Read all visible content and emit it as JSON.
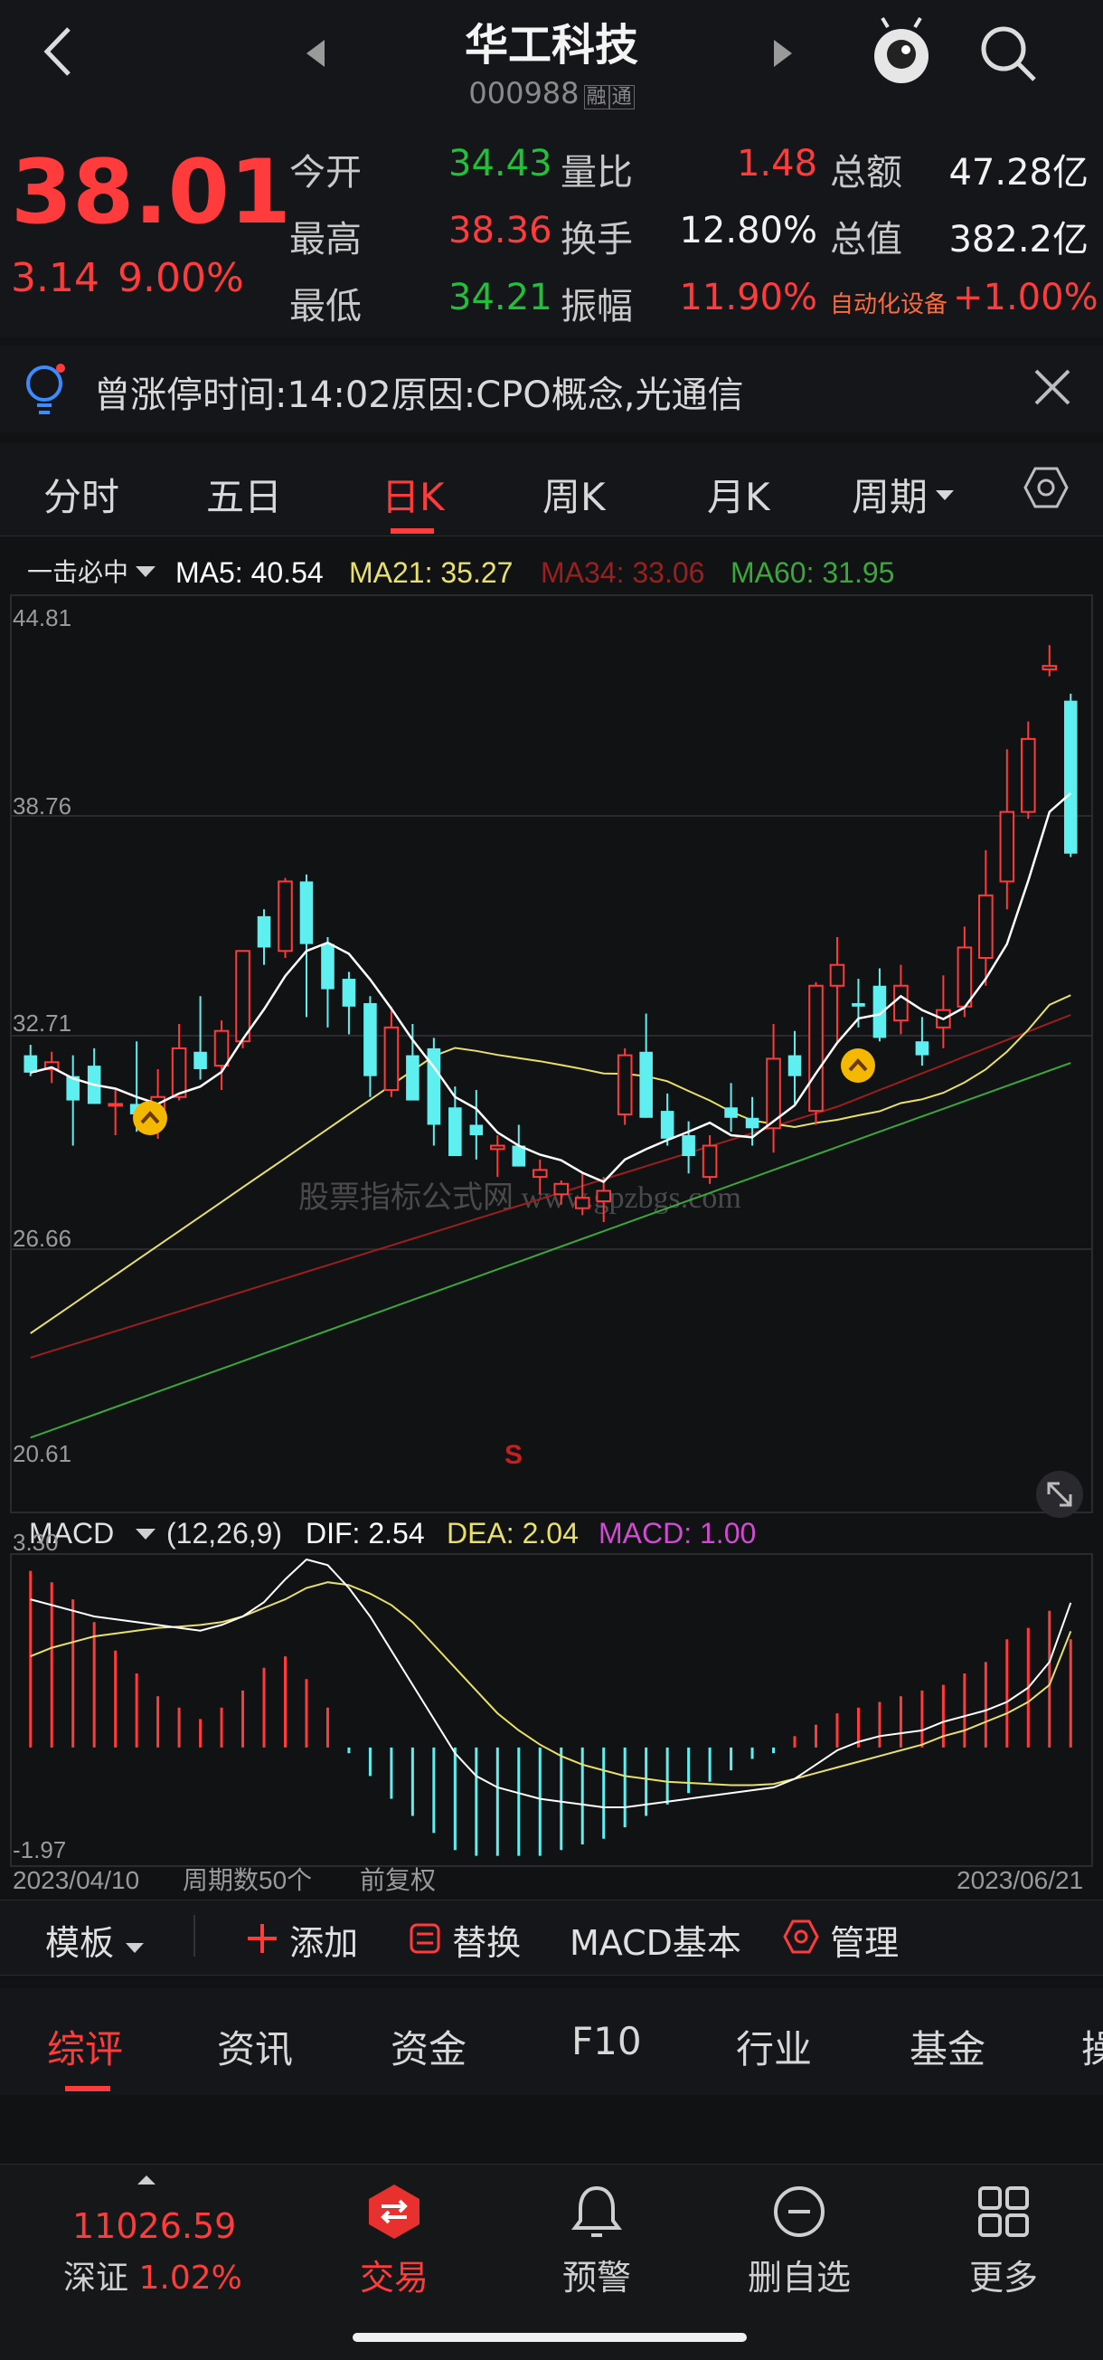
{
  "header": {
    "title": "华工科技",
    "code": "000988",
    "badges": [
      "融",
      "通"
    ]
  },
  "quote": {
    "price": "38.01",
    "change": "3.14",
    "change_pct": "9.00%",
    "rows": [
      [
        {
          "label": "今开",
          "value": "34.43"
        },
        {
          "label": "量比",
          "value": "1.48"
        },
        {
          "label": "总额",
          "value": "47.28亿"
        }
      ],
      [
        {
          "label": "最高",
          "value": "38.36"
        },
        {
          "label": "换手",
          "value": "12.80%"
        },
        {
          "label": "总值",
          "value": "382.2亿"
        }
      ],
      [
        {
          "label": "最低",
          "value": "34.21"
        },
        {
          "label": "振幅",
          "value": "11.90%"
        },
        {
          "label": "自动化设备",
          "value": "+1.00%"
        }
      ]
    ]
  },
  "notice": {
    "text": "曾涨停时间:14:02原因:CPO概念,光通信"
  },
  "tabs": [
    "分时",
    "五日",
    "日K",
    "周K",
    "月K",
    "周期"
  ],
  "active_tab": "日K",
  "indicator": {
    "name": "一击必中",
    "ma5": "MA5: 40.54",
    "ma21": "MA21: 35.27",
    "ma34": "MA34: 33.06",
    "ma60": "MA60: 31.95"
  },
  "price_axis": [
    "44.81",
    "38.76",
    "32.71",
    "26.66",
    "20.61"
  ],
  "watermark": "股票指标公式网 www.gpzbgs.com",
  "signal_mark": "S",
  "macd": {
    "name": "MACD",
    "params": "(12,26,9)",
    "dif": "DIF: 2.54",
    "dea": "DEA: 2.04",
    "macd": "MACD: 1.00",
    "axis_top": "3.30",
    "axis_bottom": "-1.97"
  },
  "date_row": {
    "start": "2023/04/10",
    "period": "周期数50个",
    "adjust": "前复权",
    "end": "2023/06/21"
  },
  "toolbar": {
    "template": "模板",
    "add": "添加",
    "replace": "替换",
    "macd_basic": "MACD基本",
    "manage": "管理"
  },
  "subtabs": [
    "综评",
    "资讯",
    "资金",
    "F10",
    "行业",
    "基金",
    "操"
  ],
  "bottom_nav": {
    "index_value": "11026.59",
    "index_name": "深证",
    "index_change": "1.02%",
    "items": [
      "交易",
      "预警",
      "删自选",
      "更多"
    ]
  },
  "colors": {
    "up": "#ff3b3b",
    "down": "#5ef0f0",
    "ma5": "#ffffff",
    "ma21": "#e8e06a",
    "ma34": "#9c1f1f",
    "ma60": "#3aa83a",
    "macd_purple": "#d14ad1"
  },
  "chart_data": {
    "type": "candlestick",
    "x_range": [
      "2023/04/10",
      "2023/06/21"
    ],
    "ylim": [
      20.61,
      44.81
    ],
    "candles": [
      [
        32.2,
        32.5,
        31.6,
        31.7
      ],
      [
        31.8,
        32.3,
        31.4,
        32.0
      ],
      [
        31.6,
        32.2,
        29.6,
        30.9
      ],
      [
        31.9,
        32.4,
        30.8,
        30.8
      ],
      [
        30.8,
        31.2,
        29.9,
        30.8
      ],
      [
        30.8,
        32.6,
        30.0,
        30.5
      ],
      [
        30.5,
        31.8,
        29.8,
        31.0
      ],
      [
        31.0,
        33.1,
        30.9,
        32.4
      ],
      [
        32.3,
        33.9,
        31.5,
        31.8
      ],
      [
        31.9,
        33.2,
        31.2,
        32.9
      ],
      [
        32.6,
        35.2,
        32.4,
        35.2
      ],
      [
        36.2,
        36.4,
        34.8,
        35.3
      ],
      [
        35.2,
        37.3,
        35.0,
        37.2
      ],
      [
        37.2,
        37.4,
        33.3,
        35.4
      ],
      [
        35.4,
        35.6,
        33.0,
        34.1
      ],
      [
        34.4,
        34.6,
        32.8,
        33.6
      ],
      [
        33.7,
        33.9,
        31.0,
        31.6
      ],
      [
        31.2,
        33.6,
        31.0,
        33.0
      ],
      [
        32.2,
        33.1,
        30.9,
        30.9
      ],
      [
        32.4,
        32.7,
        29.6,
        30.2
      ],
      [
        30.7,
        31.3,
        29.3,
        29.3
      ],
      [
        30.2,
        31.2,
        29.2,
        29.9
      ],
      [
        29.5,
        29.9,
        28.7,
        29.6
      ],
      [
        29.6,
        30.2,
        29.0,
        29.0
      ],
      [
        28.7,
        29.2,
        28.2,
        28.9
      ],
      [
        28.2,
        28.6,
        27.9,
        28.5
      ],
      [
        27.8,
        28.8,
        27.6,
        28.1
      ],
      [
        28.0,
        28.7,
        27.4,
        28.3
      ],
      [
        30.5,
        32.4,
        30.2,
        32.2
      ],
      [
        32.3,
        33.4,
        30.4,
        30.4
      ],
      [
        30.6,
        31.1,
        29.6,
        29.8
      ],
      [
        29.9,
        30.3,
        28.8,
        29.3
      ],
      [
        28.7,
        29.9,
        28.5,
        29.6
      ],
      [
        30.7,
        31.4,
        30.0,
        30.4
      ],
      [
        30.4,
        31.0,
        29.6,
        30.1
      ],
      [
        30.1,
        33.1,
        29.4,
        32.1
      ],
      [
        32.2,
        32.9,
        30.8,
        31.6
      ],
      [
        30.6,
        34.3,
        30.2,
        34.2
      ],
      [
        34.2,
        35.6,
        32.6,
        34.8
      ],
      [
        33.7,
        34.4,
        33.0,
        33.6
      ],
      [
        34.2,
        34.7,
        32.6,
        32.7
      ],
      [
        33.2,
        34.8,
        32.8,
        34.2
      ],
      [
        32.6,
        33.3,
        31.9,
        32.2
      ],
      [
        33.0,
        34.5,
        32.4,
        33.5
      ],
      [
        33.6,
        35.9,
        33.3,
        35.3
      ],
      [
        35.0,
        38.1,
        34.2,
        36.8
      ],
      [
        37.2,
        41.0,
        36.4,
        39.2
      ],
      [
        39.2,
        41.8,
        39.0,
        41.3
      ],
      [
        43.3,
        44.0,
        43.1,
        43.4
      ],
      [
        42.4,
        42.6,
        37.9,
        38.0
      ]
    ],
    "macd_hist": [
      3.1,
      2.9,
      2.6,
      2.2,
      1.7,
      1.3,
      0.9,
      0.7,
      0.5,
      0.7,
      1.0,
      1.4,
      1.6,
      1.2,
      0.7,
      -0.1,
      -0.5,
      -0.9,
      -1.2,
      -1.5,
      -1.8,
      -1.9,
      -1.9,
      -1.9,
      -1.9,
      -1.8,
      -1.7,
      -1.6,
      -1.4,
      -1.2,
      -1.0,
      -0.8,
      -0.6,
      -0.4,
      -0.2,
      -0.1,
      0.2,
      0.4,
      0.6,
      0.7,
      0.8,
      0.9,
      1.0,
      1.1,
      1.3,
      1.5,
      1.9,
      2.1,
      2.4,
      1.9
    ],
    "series": [
      {
        "name": "DIF",
        "values": [
          2.6,
          2.5,
          2.4,
          2.3,
          2.25,
          2.2,
          2.15,
          2.1,
          2.05,
          2.15,
          2.3,
          2.55,
          2.95,
          3.3,
          3.2,
          2.8,
          2.3,
          1.7,
          1.1,
          0.5,
          -0.1,
          -0.5,
          -0.7,
          -0.8,
          -0.9,
          -0.95,
          -1.0,
          -1.05,
          -1.05,
          -1.0,
          -0.95,
          -0.9,
          -0.85,
          -0.8,
          -0.75,
          -0.7,
          -0.55,
          -0.3,
          -0.05,
          0.1,
          0.2,
          0.25,
          0.3,
          0.45,
          0.55,
          0.65,
          0.8,
          1.05,
          1.5,
          2.54
        ]
      },
      {
        "name": "DEA",
        "values": [
          1.6,
          1.75,
          1.85,
          1.95,
          2.0,
          2.05,
          2.1,
          2.12,
          2.15,
          2.2,
          2.3,
          2.45,
          2.6,
          2.8,
          2.9,
          2.85,
          2.7,
          2.5,
          2.2,
          1.8,
          1.4,
          1.0,
          0.6,
          0.3,
          0.05,
          -0.15,
          -0.3,
          -0.4,
          -0.5,
          -0.55,
          -0.6,
          -0.62,
          -0.64,
          -0.66,
          -0.66,
          -0.64,
          -0.55,
          -0.45,
          -0.35,
          -0.25,
          -0.15,
          -0.05,
          0.05,
          0.2,
          0.3,
          0.45,
          0.6,
          0.8,
          1.1,
          2.04
        ]
      }
    ]
  }
}
